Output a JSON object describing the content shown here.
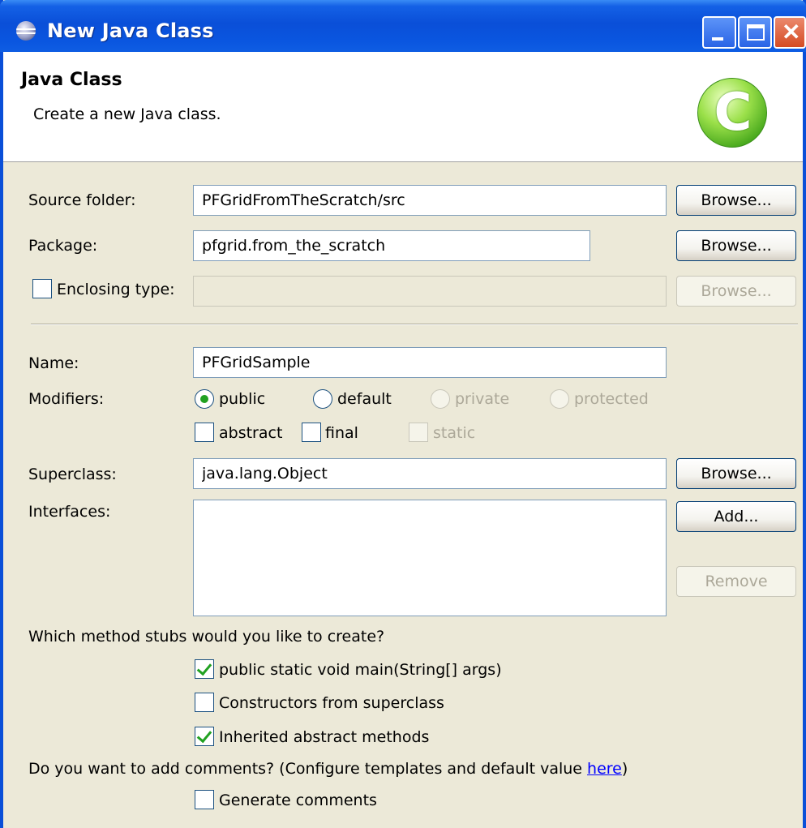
{
  "window": {
    "title": "New Java Class"
  },
  "banner": {
    "title": "Java Class",
    "description": "Create a new Java class."
  },
  "source_folder": {
    "label": "Source folder:",
    "value": "PFGridFromTheScratch/src",
    "browse_label": "Browse..."
  },
  "package": {
    "label": "Package:",
    "value": "pfgrid.from_the_scratch",
    "browse_label": "Browse..."
  },
  "enclosing_type": {
    "label": "Enclosing type:",
    "value": "",
    "checked": false,
    "browse_label": "Browse..."
  },
  "name": {
    "label": "Name:",
    "value": "PFGridSample"
  },
  "modifiers": {
    "label": "Modifiers:",
    "public_label": "public",
    "default_label": "default",
    "private_label": "private",
    "protected_label": "protected",
    "abstract_label": "abstract",
    "final_label": "final",
    "static_label": "static",
    "selected": "public"
  },
  "superclass": {
    "label": "Superclass:",
    "value": "java.lang.Object",
    "browse_label": "Browse..."
  },
  "interfaces": {
    "label": "Interfaces:",
    "add_label": "Add...",
    "remove_label": "Remove",
    "items": []
  },
  "stubs": {
    "question": "Which method stubs would you like to create?",
    "main_label": "public static void main(String[] args)",
    "main_checked": true,
    "constructors_label": "Constructors from superclass",
    "constructors_checked": false,
    "inherited_label": "Inherited abstract methods",
    "inherited_checked": true
  },
  "comments": {
    "question": "Do you want to add comments? (Configure templates and default value ",
    "link_label": "here",
    "question_end": ")",
    "generate_label": "Generate comments",
    "generate_checked": false
  },
  "colors": {
    "title_bar": "#0a4fd8",
    "dialog_bg": "#ece9d8",
    "check_green": "#21a121",
    "link": "#0000ff"
  }
}
